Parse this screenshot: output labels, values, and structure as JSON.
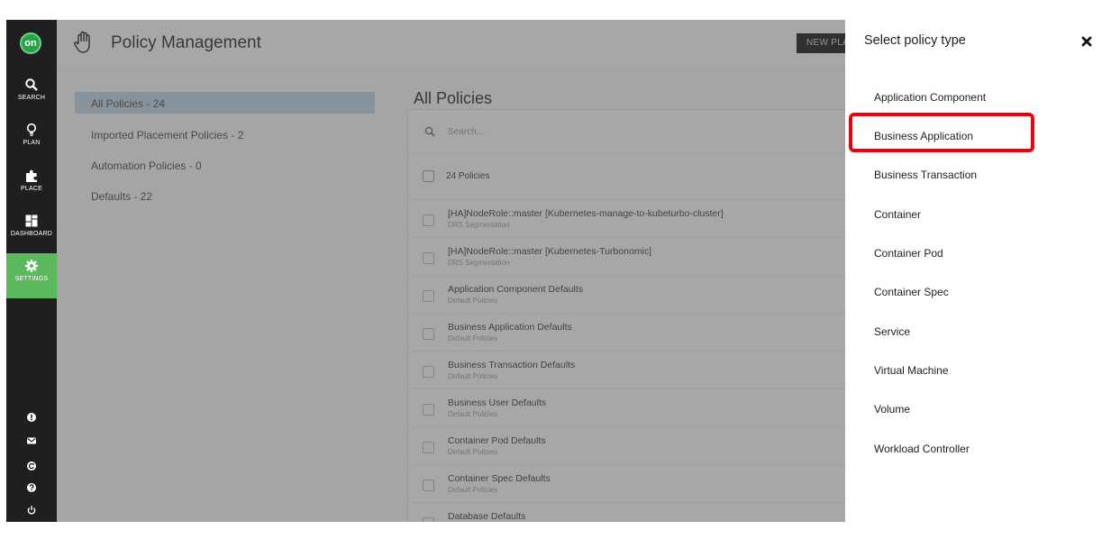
{
  "app": {
    "logo_text": "on",
    "title": "Policy Management",
    "new_button": "NEW PLA"
  },
  "nav": [
    {
      "label": "SEARCH",
      "icon": "search-icon"
    },
    {
      "label": "PLAN",
      "icon": "lightbulb-icon"
    },
    {
      "label": "PLACE",
      "icon": "puzzle-icon"
    },
    {
      "label": "DASHBOARD",
      "icon": "dashboard-icon"
    },
    {
      "label": "SETTINGS",
      "icon": "gear-icon",
      "active": true
    }
  ],
  "nav_bottom_icons": [
    "alert-icon",
    "mail-icon",
    "refresh-icon",
    "help-icon",
    "power-icon"
  ],
  "sidebar": [
    {
      "label": "All Policies - 24",
      "active": true
    },
    {
      "label": "Imported Placement Policies - 2"
    },
    {
      "label": "Automation Policies - 0"
    },
    {
      "label": "Defaults - 22"
    }
  ],
  "list": {
    "title": "All Policies",
    "search_placeholder": "Search...",
    "count_label": "24 Policies",
    "rows": [
      {
        "name": "[HA]NodeRole::master [Kubernetes-manage-to-kubeturbo-cluster]",
        "sub": "DRS Segmentation"
      },
      {
        "name": "[HA]NodeRole::master [Kubernetes-Turbonomic]",
        "sub": "DRS Segmentation"
      },
      {
        "name": "Application Component Defaults",
        "sub": "Default Policies"
      },
      {
        "name": "Business Application Defaults",
        "sub": "Default Policies"
      },
      {
        "name": "Business Transaction Defaults",
        "sub": "Default Policies"
      },
      {
        "name": "Business User Defaults",
        "sub": "Default Policies"
      },
      {
        "name": "Container Pod Defaults",
        "sub": "Default Policies"
      },
      {
        "name": "Container Spec Defaults",
        "sub": "Default Policies"
      },
      {
        "name": "Database Defaults",
        "sub": ""
      }
    ]
  },
  "panel": {
    "title": "Select policy type",
    "close_icon": "close-icon",
    "highlight_color": "#e8000e",
    "highlighted_option": "Business Application",
    "options": [
      "Application Component",
      "Business Application",
      "Business Transaction",
      "Container",
      "Container Pod",
      "Container Spec",
      "Service",
      "Virtual Machine",
      "Volume",
      "Workload Controller"
    ]
  },
  "colors": {
    "nav_bg": "#1f1f1f",
    "nav_active": "#5cb85c",
    "logo": "#2aa24a",
    "sidebar_active": "#bcd6ea"
  }
}
